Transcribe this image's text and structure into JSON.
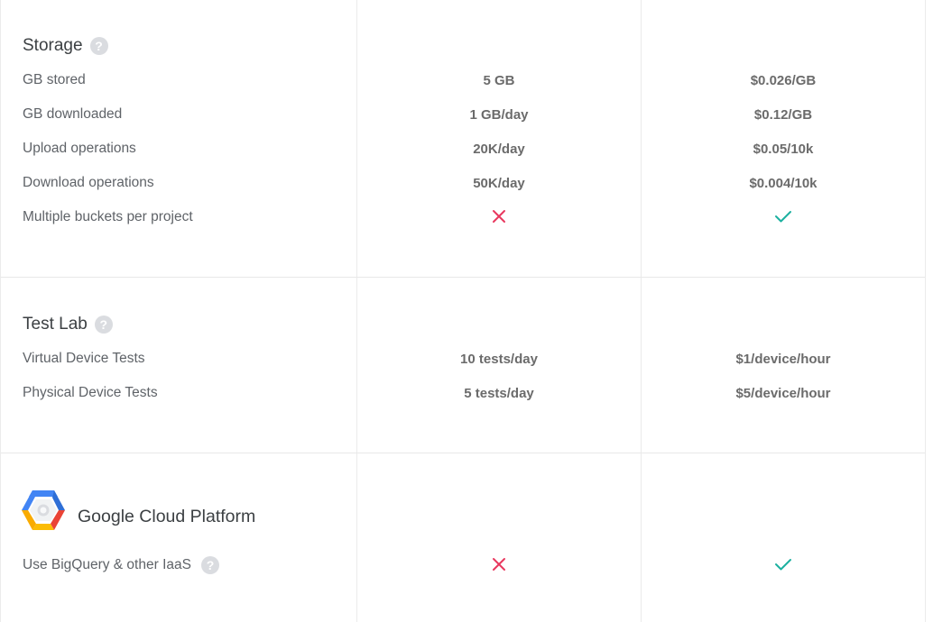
{
  "storage": {
    "title": "Storage",
    "rows": [
      {
        "label": "GB stored",
        "free": "5 GB",
        "paid": "$0.026/GB"
      },
      {
        "label": "GB downloaded",
        "free": "1 GB/day",
        "paid": "$0.12/GB"
      },
      {
        "label": "Upload operations",
        "free": "20K/day",
        "paid": "$0.05/10k"
      },
      {
        "label": "Download operations",
        "free": "50K/day",
        "paid": "$0.004/10k"
      },
      {
        "label": "Multiple buckets per project",
        "free_icon": "cross-icon",
        "paid_icon": "check-icon"
      }
    ]
  },
  "test_lab": {
    "title": "Test Lab",
    "rows": [
      {
        "label": "Virtual Device Tests",
        "free": "10 tests/day",
        "paid": "$1/device/hour"
      },
      {
        "label": "Physical Device Tests",
        "free": "5 tests/day",
        "paid": "$5/device/hour"
      }
    ]
  },
  "gcp": {
    "title": "Google Cloud Platform",
    "logo_icon": "google-cloud-platform-logo",
    "rows": [
      {
        "label": "Use BigQuery & other IaaS",
        "free_icon": "cross-icon",
        "paid_icon": "check-icon"
      }
    ]
  },
  "help_glyph": "?",
  "colors": {
    "cross": "#e8385e",
    "check": "#1cb0a0",
    "divider": "#ebebeb",
    "help_icon": "#dadce0"
  }
}
